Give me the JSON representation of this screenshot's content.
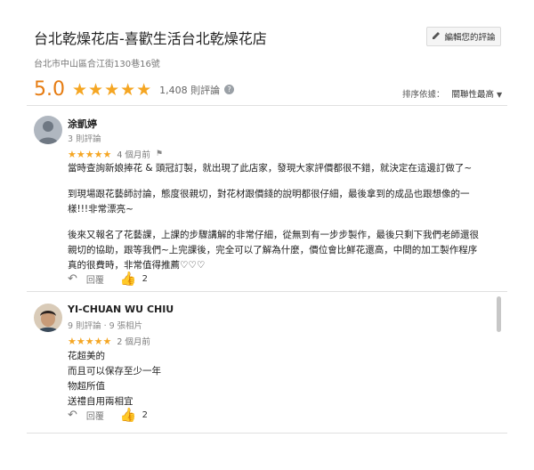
{
  "place": {
    "title": "台北乾燥花店-喜歡生活台北乾燥花店",
    "address": "台北市中山區合江街130巷16號",
    "edit_label": "編輯您的評論"
  },
  "summary": {
    "rating": "5.0",
    "stars": "★★★★★",
    "count": "1,408 則評論",
    "sort_label": "排序依據：",
    "sort_value": "關聯性最高"
  },
  "reviews": [
    {
      "name": "涂凱婷",
      "meta": "3 則評論",
      "stars": "★★★★★",
      "time": "4 個月前",
      "paragraphs": [
        "當時查詢新娘捧花 & 頭冠訂製，就出現了此店家，發現大家評價都很不錯，就決定在這邊訂做了~",
        "到現場跟花藝師討論，態度很親切，對花材跟價錢的說明都很仔細，最後拿到的成品也跟想像的一樣!!!非常漂亮~",
        "後來又報名了花藝課，上課的步驟講解的非常仔細，從無到有一步步製作，最後只剩下我們老師還很親切的協助，跟等我們~上完課後，完全可以了解為什麼，價位會比鮮花還高，中間的加工製作程序真的很費時，非常值得推薦♡♡♡"
      ],
      "reply": "回覆",
      "likes": "2"
    },
    {
      "name": "YI-CHUAN WU CHIU",
      "meta": "9 則評論 · 9 張相片",
      "stars": "★★★★★",
      "time": "2 個月前",
      "lines": [
        "花超美的",
        "而且可以保存至少一年",
        "物超所值",
        "送禮自用兩相宜"
      ],
      "reply": "回覆",
      "likes": "2"
    }
  ],
  "icons": {
    "edit": "pencil-icon",
    "help": "help-icon",
    "sort": "chevron-down-icon",
    "flag": "flag-icon",
    "reply": "reply-icon",
    "like": "thumbs-up-icon"
  },
  "colors": {
    "rating": "#e67c12",
    "star": "#f5a623",
    "like": "#1a73e8"
  }
}
